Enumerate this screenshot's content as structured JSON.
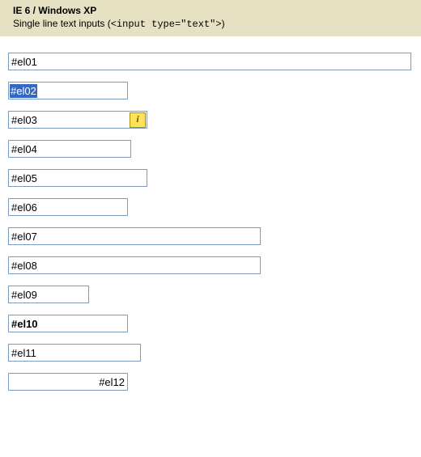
{
  "header": {
    "line1": "IE 6 / Windows XP",
    "line2_pre": "Single line text inputs (",
    "line2_code": "<input type=\"text\">",
    "line2_post": ")"
  },
  "inputs": {
    "el01": "#el01",
    "el02": "#el02",
    "el03": "#el03",
    "el03_badge": "i",
    "el04": "#el04",
    "el05": "#el05",
    "el06": "#el06",
    "el07": "#el07",
    "el08": "#el08",
    "el09": "#el09",
    "el10": "#el10",
    "el11": "#el11",
    "el12": "#el12"
  }
}
